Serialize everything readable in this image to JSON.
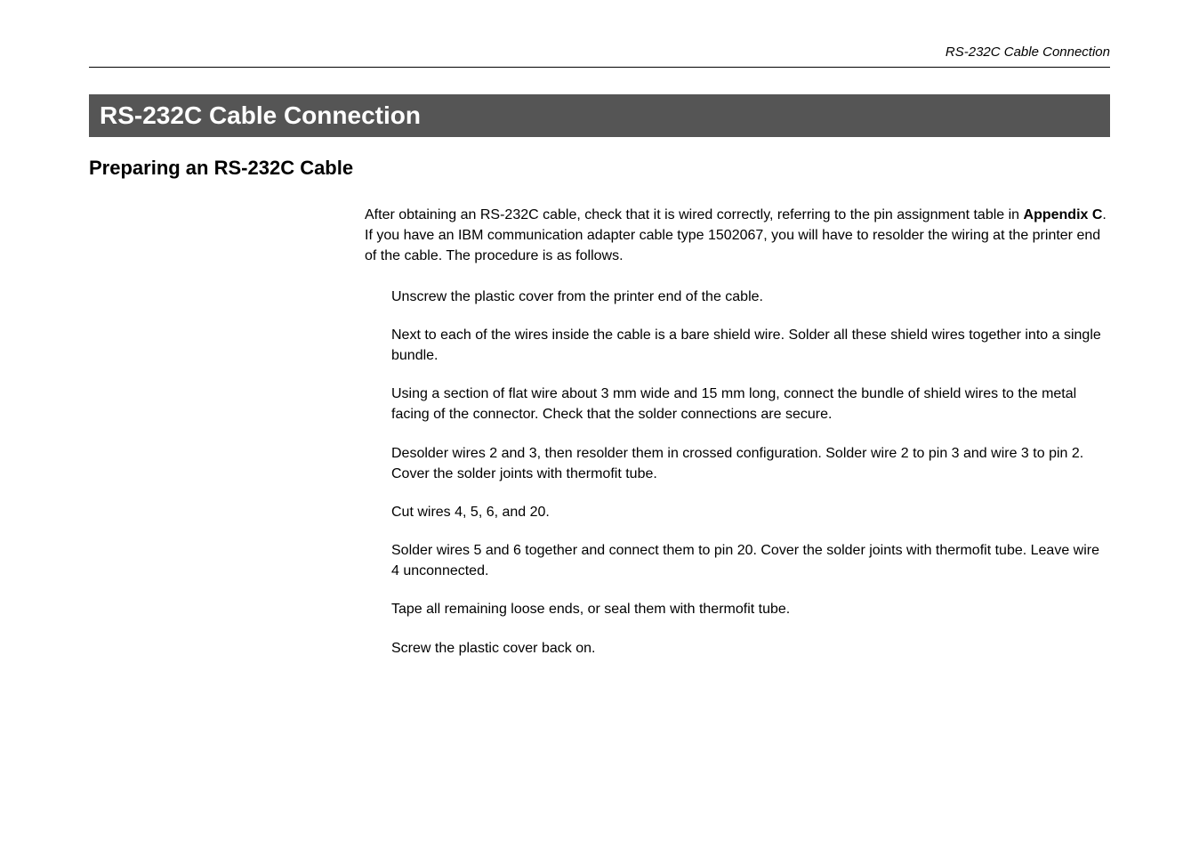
{
  "header": {
    "running_title": "RS-232C Cable Connection"
  },
  "section": {
    "title": "RS-232C Cable Connection"
  },
  "subsection": {
    "title": "Preparing an RS-232C Cable"
  },
  "intro": {
    "part1": "After obtaining an RS-232C cable, check that it is wired correctly, referring to the pin assignment table   in ",
    "ref": "Appendix C",
    "part2": ". If you have an IBM communication adapter cable type 1502067, you will have to  resolder the wiring at the printer end of the cable. The procedure is as follows."
  },
  "steps": [
    "Unscrew the plastic cover from the printer end of the cable.",
    "Next to each of the wires inside the cable is a bare shield wire. Solder all these shield wires together into a single bundle.",
    "Using a section of flat wire about 3 mm wide and 15 mm long, connect the bundle of shield wires to the metal facing of the connector. Check that the solder connections are secure.",
    "Desolder wires 2 and 3, then resolder them in crossed configuration. Solder wire 2 to pin 3 and wire 3 to pin 2. Cover the solder joints with thermofit tube.",
    "Cut wires 4, 5, 6, and 20.",
    "Solder wires 5 and 6 together and connect them to pin 20. Cover the solder joints with thermofit tube. Leave wire 4 unconnected.",
    "Tape all remaining loose ends, or seal them with thermofit tube.",
    "Screw the plastic cover back on."
  ]
}
